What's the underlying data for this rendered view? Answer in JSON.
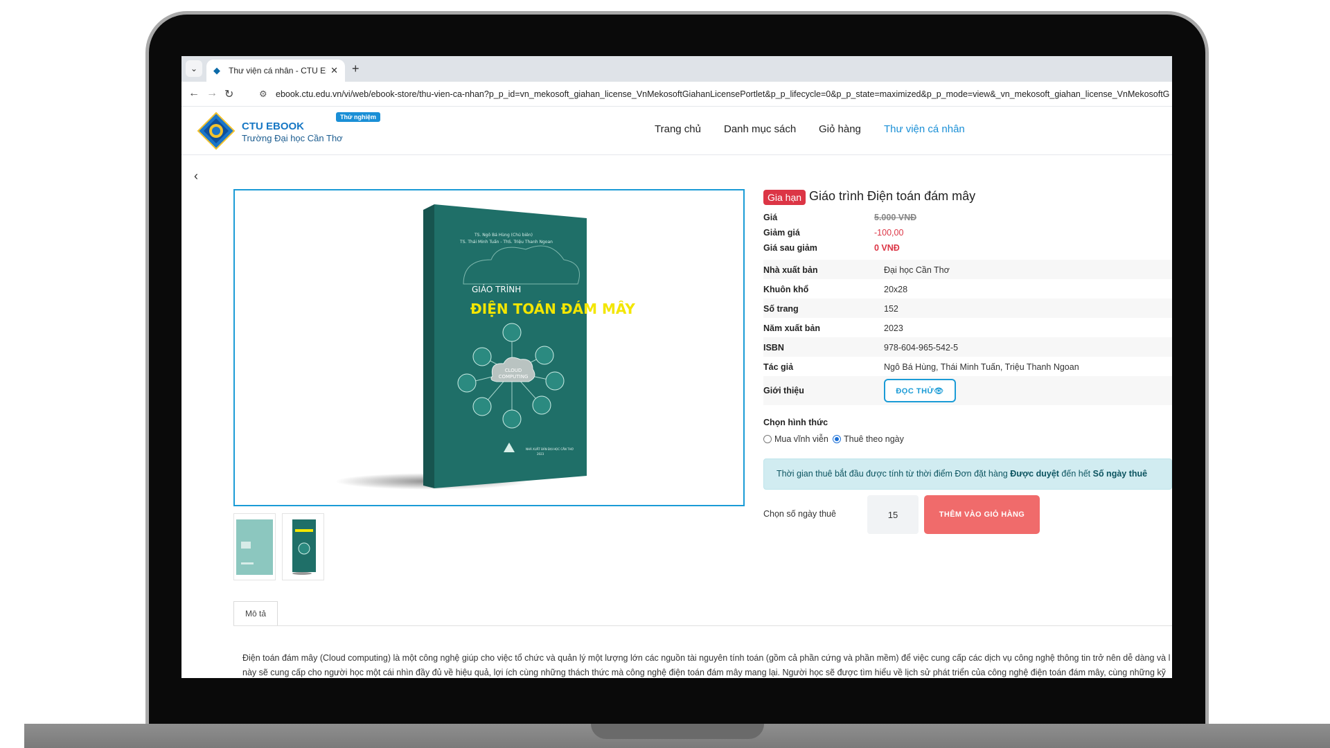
{
  "browser": {
    "tab_title": "Thư viện cá nhân - CTU Ebook",
    "tab_close": "✕",
    "new_tab": "+",
    "url": "ebook.ctu.edu.vn/vi/web/ebook-store/thu-vien-ca-nhan?p_p_id=vn_mekosoft_giahan_license_VnMekosoftGiahanLicensePortlet&p_p_lifecycle=0&p_p_state=maximized&p_p_mode=view&_vn_mekosoft_giahan_license_VnMekosoftGiahanLicen"
  },
  "header": {
    "brand_name": "CTU EBOOK",
    "brand_subtitle": "Trường Đại học Cần Thơ",
    "badge": "Thử nghiệm",
    "menu": [
      {
        "label": "Trang chủ"
      },
      {
        "label": "Danh mục sách"
      },
      {
        "label": "Giỏ hàng"
      },
      {
        "label": "Thư viện cá nhân",
        "active": true
      }
    ]
  },
  "book_cover": {
    "authors_line1": "TS. Ngô Bá Hùng (Chủ biên)",
    "authors_line2": "TS. Thái Minh Tuấn - ThS. Triệu Thanh Ngoan",
    "series": "GIÁO TRÌNH",
    "title": "ĐIỆN TOÁN ĐÁM MÂY",
    "cloud1": "CLOUD",
    "cloud2": "COMPUTING",
    "publisher": "NHÀ XUẤT BẢN ĐẠI HỌC CẦN THƠ",
    "year": "2023"
  },
  "product": {
    "status_badge": "Gia hạn",
    "title": "Giáo trình Điện toán đám mây",
    "price_label": "Giá",
    "price": "5.000 VNĐ",
    "discount_label": "Giảm giá",
    "discount": "-100,00",
    "final_label": "Giá sau giảm",
    "final_price": "0 VNĐ",
    "specs": [
      {
        "label": "Nhà xuất bản",
        "value": "Đại học Cần Thơ"
      },
      {
        "label": "Khuôn khổ",
        "value": "20x28"
      },
      {
        "label": "Số trang",
        "value": "152"
      },
      {
        "label": "Năm xuất bản",
        "value": "2023"
      },
      {
        "label": "ISBN",
        "value": "978-604-965-542-5"
      },
      {
        "label": "Tác giả",
        "value": "Ngô Bá Hùng, Thái Minh Tuấn, Triệu Thanh Ngoan"
      }
    ],
    "intro_label": "Giới thiệu",
    "read_button": "ĐỌC THỬ👁",
    "format_label": "Chọn hình thức",
    "format_options": [
      "Mua vĩnh viễn",
      "Thuê theo ngày"
    ],
    "format_selected": "Thuê theo ngày",
    "notice_prefix": "Thời gian thuê bắt đầu được tính từ thời điểm Đơn đặt hàng ",
    "notice_bold1": "Được duyệt",
    "notice_mid": " đến hết ",
    "notice_bold2": "Số ngày thuê",
    "days_label": "Chọn số ngày thuê",
    "days_value": "15",
    "add_cart_button": "THÊM VÀO GIỎ HÀNG"
  },
  "description": {
    "tab_label": "Mô tả",
    "line1": "Điện toán đám mây (Cloud computing) là một công nghệ giúp cho việc tổ chức và quản lý một lượng lớn các nguồn tài nguyên tính toán (gồm cả phần cứng và phần mềm) để việc cung cấp các dịch vụ công nghệ thông tin trở nên dễ dàng và l",
    "line2": "này sẽ cung cấp cho người học một cái nhìn đầy đủ về hiệu quả, lợi ích cùng những thách thức mà công nghệ điện toán đám mây mang lại. Người học sẽ được tìm hiểu về lịch sử phát triển của công nghệ điện toán đám mây, cùng những kỹ"
  },
  "colors": {
    "accent": "#1a9bd6",
    "danger": "#dc3545",
    "cart_button": "#f06b6b",
    "cover_teal": "#1f6f68",
    "cover_title": "#f3e600"
  }
}
